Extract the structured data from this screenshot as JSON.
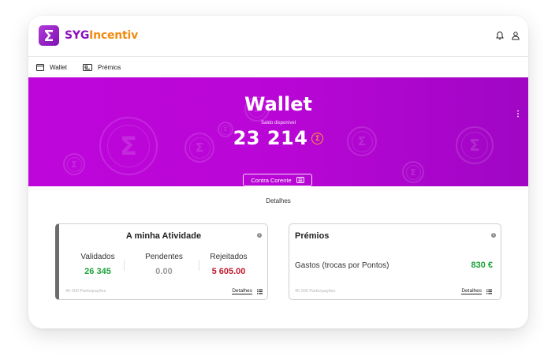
{
  "app": {
    "logo_part1": "SYG",
    "logo_part2": "Incentiv",
    "brand_color": "#8b12c0",
    "accent_color": "#f18b11"
  },
  "header_icons": [
    "bell-icon",
    "user-icon"
  ],
  "nav": {
    "items": [
      {
        "label": "Wallet",
        "icon": "wallet-icon"
      },
      {
        "label": "Prémios",
        "icon": "gift-icon"
      }
    ]
  },
  "banner": {
    "title": "Wallet",
    "balance_caption": "Saldo disponível",
    "balance": "23 214",
    "currency_symbol": "Σ",
    "button_label": "Contra Corente",
    "bg_color": "#be06da"
  },
  "section_title": "Detalhes",
  "activity_card": {
    "title": "A minha Atividade",
    "info_icon": "i",
    "stats": [
      {
        "label": "Validados",
        "value": "26 345",
        "color": "#1aa33a"
      },
      {
        "label": "Pendentes",
        "value": "0.00",
        "color": "#9a9a9a"
      },
      {
        "label": "Rejeitados",
        "value": "5 605.00",
        "color": "#c0182e"
      }
    ],
    "footnote": "46 000 Participações",
    "details_link": "Detalhes"
  },
  "prizes_card": {
    "title": "Prémios",
    "info_icon": "i",
    "row_label": "Gastos (trocas por Pontos)",
    "row_value": "830 €",
    "footnote": "46 000 Participações",
    "details_link": "Detalhes"
  }
}
